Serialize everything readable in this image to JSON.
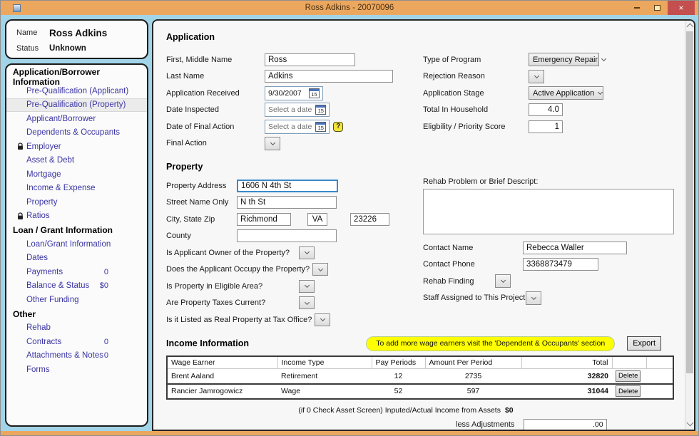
{
  "window": {
    "title": "Ross Adkins - 20070096",
    "close_glyph": "×"
  },
  "colors": {
    "titlebar": "#eca75f",
    "close_button": "#c34f4f",
    "sidebar_bg": "#a2d4e8",
    "nav_link": "#3b35a4",
    "notice_bg": "#ffff00"
  },
  "sidebar": {
    "profile": {
      "name_label": "Name",
      "name_value": "Ross Adkins",
      "status_label": "Status",
      "status_value": "Unknown"
    },
    "section1": {
      "header": "Application/Borrower Information",
      "items": [
        {
          "label": "Pre-Qualification (Applicant)"
        },
        {
          "label": "Pre-Qualification (Property)",
          "selected": true
        },
        {
          "label": "Applicant/Borrower"
        },
        {
          "label": "Dependents & Occupants"
        },
        {
          "label": "Employer",
          "locked": true
        },
        {
          "label": "Asset & Debt"
        },
        {
          "label": "Mortgage"
        },
        {
          "label": "Income & Expense"
        },
        {
          "label": "Property"
        },
        {
          "label": "Ratios",
          "locked": true
        }
      ]
    },
    "section2": {
      "header": "Loan / Grant Information",
      "items": [
        {
          "label": "Loan/Grant Information"
        },
        {
          "label": "Dates"
        },
        {
          "label": "Payments",
          "count": "0"
        },
        {
          "label": "Balance & Status",
          "count": "$0"
        },
        {
          "label": "Other Funding"
        }
      ]
    },
    "section3": {
      "header": "Other",
      "items": [
        {
          "label": "Rehab"
        },
        {
          "label": "Contracts",
          "count": "0"
        },
        {
          "label": "Attachments & Notes",
          "count": "0"
        },
        {
          "label": "Forms"
        }
      ]
    }
  },
  "application": {
    "heading": "Application",
    "first_middle_label": "First, Middle Name",
    "first_middle_value": "Ross",
    "last_name_label": "Last Name",
    "last_name_value": "Adkins",
    "app_received_label": "Application Received",
    "app_received_value": "9/30/2007",
    "date_inspected_label": "Date Inspected",
    "date_inspected_placeholder": "Select a date",
    "final_action_date_label": "Date of Final Action",
    "final_action_date_placeholder": "Select a date",
    "final_action_label": "Final Action",
    "type_of_program_label": "Type of Program",
    "type_of_program_value": "Emergency Repair",
    "rejection_reason_label": "Rejection Reason",
    "application_stage_label": "Application Stage",
    "application_stage_value": "Active Application",
    "total_household_label": "Total In Household",
    "total_household_value": "4.0",
    "eligibility_label": "Eligbility / Priority Score",
    "eligibility_value": "1",
    "calendar_icon_text": "15",
    "help_icon_text": "?"
  },
  "property": {
    "heading": "Property",
    "address_label": "Property Address",
    "address_value": "1606 N 4th St",
    "street_label": "Street Name Only",
    "street_value": "N th St",
    "city_state_zip_label": "City, State Zip",
    "city_value": "Richmond",
    "state_value": "VA",
    "zip_value": "23226",
    "county_label": "County",
    "county_value": "",
    "q1": "Is Applicant Owner of the Property?",
    "q2": "Does the Applicant Occupy the Property?",
    "q3": "Is Property in Eligible Area?",
    "q4": "Are Property Taxes Current?",
    "q5": "Is it Listed as Real Property at Tax Office?",
    "rehab_problem_label": "Rehab Problem or Brief Descript:",
    "contact_name_label": "Contact Name",
    "contact_name_value": "Rebecca Waller",
    "contact_phone_label": "Contact Phone",
    "contact_phone_value": "3368873479",
    "rehab_finding_label": "Rehab Finding",
    "staff_label": "Staff Assigned to This Project"
  },
  "income": {
    "heading": "Income Information",
    "notice": "To add more wage earners visit the 'Dependent & Occupants' section",
    "export_label": "Export",
    "table": {
      "headers": {
        "wage_earner": "Wage Earner",
        "income_type": "Income Type",
        "pay_periods": "Pay Periods",
        "amount_per_period": "Amount Per Period",
        "total": "Total"
      },
      "rows": [
        {
          "wage_earner": "Brent Aaland",
          "income_type": "Retirement",
          "pay_periods": "12",
          "amount_per_period": "2735",
          "total": "32820",
          "delete_label": "Delete"
        },
        {
          "wage_earner": "Rancier Jamrogowicz",
          "income_type": "Wage",
          "pay_periods": "52",
          "amount_per_period": "597",
          "total": "31044",
          "delete_label": "Delete"
        }
      ]
    },
    "assets_line_label": "(if 0 Check Asset Screen) Inputed/Actual Income from Assets",
    "assets_line_value": "$0",
    "adjustments_label": "less Adjustments",
    "adjustments_value": ".00"
  }
}
